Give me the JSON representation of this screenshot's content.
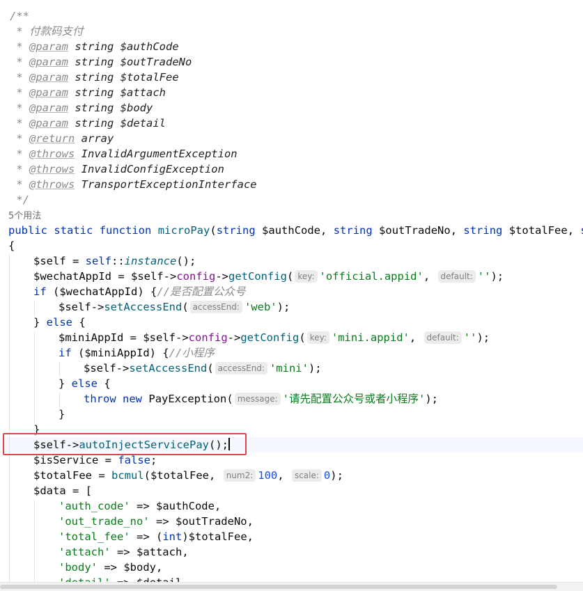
{
  "doc": {
    "open": "/**",
    "desc_star": " * ",
    "desc": "付款码支付",
    "star": " * ",
    "param_tag": "@param",
    "string_type": "string",
    "params": [
      "$authCode",
      "$outTradeNo",
      "$totalFee",
      "$attach",
      "$body",
      "$detail"
    ],
    "return_tag": "@return",
    "return_type": "array",
    "throws_tag": "@throws",
    "throws": [
      "InvalidArgumentException",
      "InvalidConfigException",
      "TransportExceptionInterface"
    ],
    "close": " */"
  },
  "usages": "5个用法",
  "signature": {
    "kw_public": "public",
    "kw_static": "static",
    "kw_function": "function",
    "name": "microPay",
    "type_string": "string",
    "p1": "$authCode",
    "p2": "$outTradeNo",
    "p3": "$totalFee",
    "tail": "stri"
  },
  "hints": {
    "key": "key:",
    "default": "default:",
    "accessEnd": "accessEnd:",
    "message": "message:",
    "num2": "num2:",
    "scale": "scale:"
  },
  "code": {
    "self_var": "$self",
    "self_kw": "self",
    "instance": "instance",
    "wechat_var": "$wechatAppId",
    "config": "config",
    "getConfig": "getConfig",
    "official_appid": "'official.appid'",
    "empty_str": "''",
    "kw_if": "if",
    "kw_else": "else",
    "cmt_official": "//是否配置公众号",
    "setAccessEnd": "setAccessEnd",
    "web": "'web'",
    "mini_var": "$miniAppId",
    "mini_appid": "'mini.appid'",
    "cmt_mini": "//小程序",
    "mini": "'mini'",
    "kw_throw": "throw",
    "kw_new": "new",
    "pay_exception": "PayException",
    "exception_msg": "'请先配置公众号或者小程序'",
    "autoInject": "autoInjectServicePay",
    "isService_var": "$isService",
    "kw_false": "false",
    "totalFee_var": "$totalFee",
    "bcmul": "bcmul",
    "num_100": "100",
    "num_0": "0",
    "data_var": "$data",
    "k_auth_code": "'auth_code'",
    "k_out_trade_no": "'out_trade_no'",
    "k_total_fee": "'total_fee'",
    "k_attach": "'attach'",
    "k_body": "'body'",
    "k_detail": "'detail'",
    "authCode_var": "$authCode",
    "outTradeNo_var": "$outTradeNo",
    "kw_int": "int",
    "attach_var": "$attach",
    "body_var": "$body",
    "detail_var": "$detail"
  },
  "colors": {
    "highlight_box": "#e0454e",
    "keyword": "#0033b3",
    "variable": "#871094",
    "function": "#00627a",
    "string": "#067d17",
    "number": "#1750eb",
    "comment": "#8c8c8c"
  }
}
